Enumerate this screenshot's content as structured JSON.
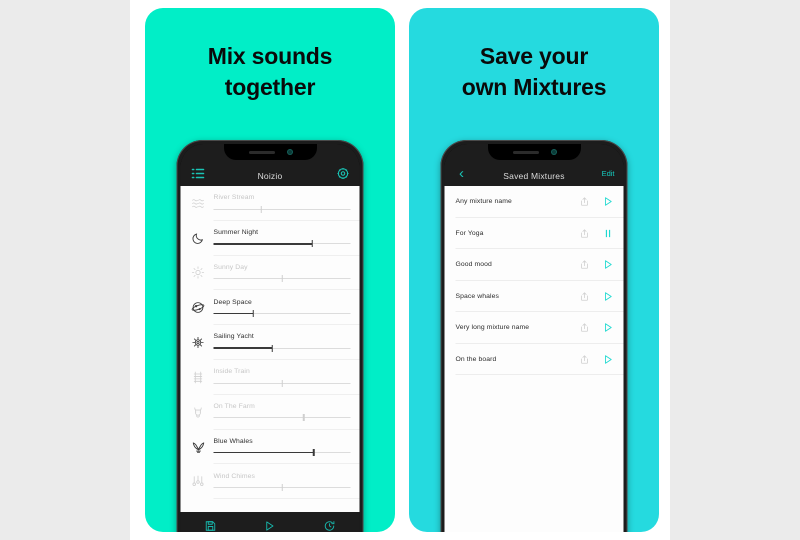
{
  "theme": {
    "page_background": "#ebebeb",
    "stage_background": "#ffffff",
    "left_panel_color": "#01eec7",
    "right_panel_color": "#25dadf",
    "accent_teal": "#1fd9d0",
    "heading_color": "#0a0a0a"
  },
  "panels": {
    "left": {
      "heading_line1": "Mix sounds",
      "heading_line2": "together",
      "phone": {
        "navbar": {
          "title": "Noizio",
          "left_icon": "list-icon",
          "right_icon": "gear-icon"
        },
        "sounds": [
          {
            "name": "River Stream",
            "icon": "waves-icon",
            "active": false,
            "value": 35
          },
          {
            "name": "Summer Night",
            "icon": "moon-icon",
            "active": true,
            "value": 72
          },
          {
            "name": "Sunny Day",
            "icon": "sun-icon",
            "active": false,
            "value": 50
          },
          {
            "name": "Deep Space",
            "icon": "planet-icon",
            "active": true,
            "value": 29
          },
          {
            "name": "Sailing Yacht",
            "icon": "ship-wheel-icon",
            "active": true,
            "value": 43
          },
          {
            "name": "Inside Train",
            "icon": "train-icon",
            "active": false,
            "value": 50
          },
          {
            "name": "On The Farm",
            "icon": "cow-icon",
            "active": false,
            "value": 66
          },
          {
            "name": "Blue Whales",
            "icon": "whale-tail-icon",
            "active": true,
            "value": 73
          },
          {
            "name": "Wind Chimes",
            "icon": "wind-chimes-icon",
            "active": false,
            "value": 50
          }
        ],
        "toolbar": [
          {
            "label": "Save mixture",
            "icon": "save-icon"
          },
          {
            "label": "Play",
            "icon": "play-icon"
          },
          {
            "label": "Timer",
            "icon": "timer-icon"
          }
        ]
      }
    },
    "right": {
      "heading_line1": "Save your",
      "heading_line2": "own Mixtures",
      "phone": {
        "navbar": {
          "title": "Saved Mixtures",
          "back_label": "‹",
          "edit_label": "Edit"
        },
        "mixtures": [
          {
            "name": "Any mixture name",
            "state": "stopped"
          },
          {
            "name": "For Yoga",
            "state": "playing"
          },
          {
            "name": "Good mood",
            "state": "stopped"
          },
          {
            "name": "Space whales",
            "state": "stopped"
          },
          {
            "name": "Very long mixture name",
            "state": "stopped"
          },
          {
            "name": "On the board",
            "state": "stopped"
          }
        ]
      }
    }
  }
}
